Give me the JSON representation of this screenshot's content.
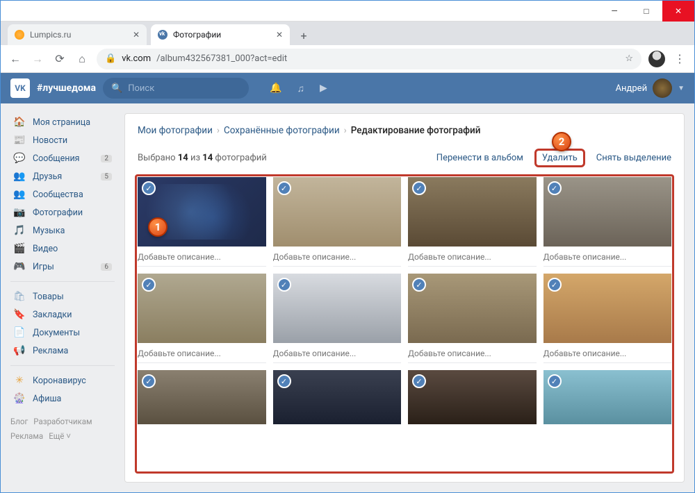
{
  "window": {
    "min": "—",
    "max": "□",
    "close": "✕"
  },
  "tabs": [
    {
      "title": "Lumpics.ru",
      "active": false
    },
    {
      "title": "Фотографии",
      "active": true
    }
  ],
  "browser": {
    "url_host": "vk.com",
    "url_path": "/album432567381_000?act=edit"
  },
  "vk": {
    "logo": "VK",
    "hashtag": "#лучшедома",
    "search_placeholder": "Поиск",
    "username": "Андрей"
  },
  "sidebar": {
    "items": [
      {
        "icon": "🏠",
        "label": "Моя страница"
      },
      {
        "icon": "📰",
        "label": "Новости"
      },
      {
        "icon": "💬",
        "label": "Сообщения",
        "badge": "2"
      },
      {
        "icon": "👥",
        "label": "Друзья",
        "badge": "5"
      },
      {
        "icon": "👥",
        "label": "Сообщества"
      },
      {
        "icon": "📷",
        "label": "Фотографии"
      },
      {
        "icon": "🎵",
        "label": "Музыка"
      },
      {
        "icon": "🎬",
        "label": "Видео"
      },
      {
        "icon": "🎮",
        "label": "Игры",
        "badge": "6"
      }
    ],
    "items2": [
      {
        "icon": "🛍",
        "label": "Товары"
      },
      {
        "icon": "🔖",
        "label": "Закладки"
      },
      {
        "icon": "📄",
        "label": "Документы"
      },
      {
        "icon": "📢",
        "label": "Реклама"
      }
    ],
    "items3": [
      {
        "icon": "✳",
        "label": "Коронавирус",
        "cls": "orange"
      },
      {
        "icon": "🎡",
        "label": "Афиша"
      }
    ],
    "footer": [
      "Блог",
      "Разработчикам",
      "Реклама",
      "Ещё ˅"
    ]
  },
  "breadcrumb": {
    "a": "Мои фотографии",
    "b": "Сохранённые фотографии",
    "c": "Редактирование фотографий"
  },
  "selection": {
    "text_pre": "Выбрано ",
    "sel": "14",
    "mid": " из ",
    "total": "14",
    "text_post": " фотографий",
    "move": "Перенести в альбом",
    "del": "Удалить",
    "deselect": "Снять выделение"
  },
  "photo_desc_placeholder": "Добавьте описание...",
  "badges": {
    "one": "1",
    "two": "2"
  }
}
